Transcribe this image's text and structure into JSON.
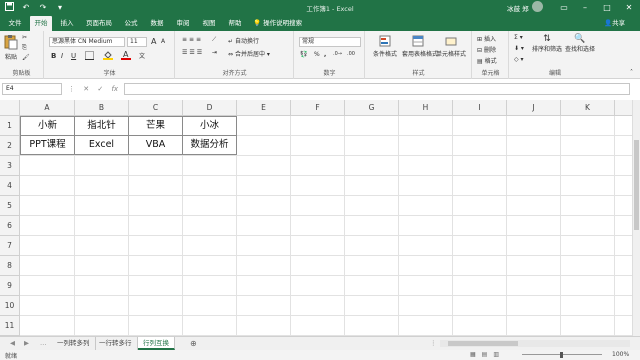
{
  "window": {
    "title": "工作簿1  -  Excel",
    "user": "冰鼓 郑"
  },
  "colors": {
    "accent": "#217346"
  },
  "quick_access": {
    "save_icon": "save-icon",
    "undo_icon": "undo-icon",
    "redo_icon": "redo-icon",
    "customize_icon": "customize-qat-icon"
  },
  "tabs": [
    {
      "label": "文件"
    },
    {
      "label": "开始"
    },
    {
      "label": "插入"
    },
    {
      "label": "页面布局"
    },
    {
      "label": "公式"
    },
    {
      "label": "数据"
    },
    {
      "label": "审阅"
    },
    {
      "label": "视图"
    },
    {
      "label": "帮助"
    }
  ],
  "tell_me": "操作说明搜索",
  "share": "共享",
  "ribbon": {
    "clipboard": {
      "paste": "粘贴",
      "label": "剪贴板"
    },
    "font": {
      "name": "思源黑体 CN Medium",
      "size": "11",
      "bold": "B",
      "italic": "I",
      "underline": "U",
      "grow": "A",
      "shrink": "A",
      "label": "字体"
    },
    "alignment": {
      "wrap": "自动换行",
      "merge": "合并后居中",
      "label": "对齐方式"
    },
    "number": {
      "format": "常规",
      "percent": "%",
      "comma": ",",
      "label": "数字"
    },
    "styles": {
      "conditional": "条件格式",
      "table": "套用表格格式",
      "cell": "单元格样式",
      "label": "样式"
    },
    "cells": {
      "insert": "插入",
      "delete": "删除",
      "format": "格式",
      "label": "单元格"
    },
    "editing": {
      "sort": "排序和筛选",
      "find": "查找和选择",
      "label": "编辑"
    }
  },
  "formula_bar": {
    "name_box": "E4",
    "formula": ""
  },
  "columns": [
    "A",
    "B",
    "C",
    "D",
    "E",
    "F",
    "G",
    "H",
    "I",
    "J",
    "K"
  ],
  "rows": [
    "1",
    "2",
    "3",
    "4",
    "5",
    "6",
    "7",
    "8",
    "9",
    "10",
    "11"
  ],
  "cells": {
    "A1": "小新",
    "B1": "指北针",
    "C1": "芒果",
    "D1": "小冰",
    "A2": "PPT课程",
    "B2": "Excel",
    "C2": "VBA",
    "D2": "数据分析"
  },
  "sheets": [
    {
      "label": "一列转多列",
      "active": false
    },
    {
      "label": "一行转多行",
      "active": false
    },
    {
      "label": "行列互换",
      "active": true
    }
  ],
  "add_sheet": "⊕",
  "status": {
    "ready": "就绪",
    "zoom": "100%"
  }
}
